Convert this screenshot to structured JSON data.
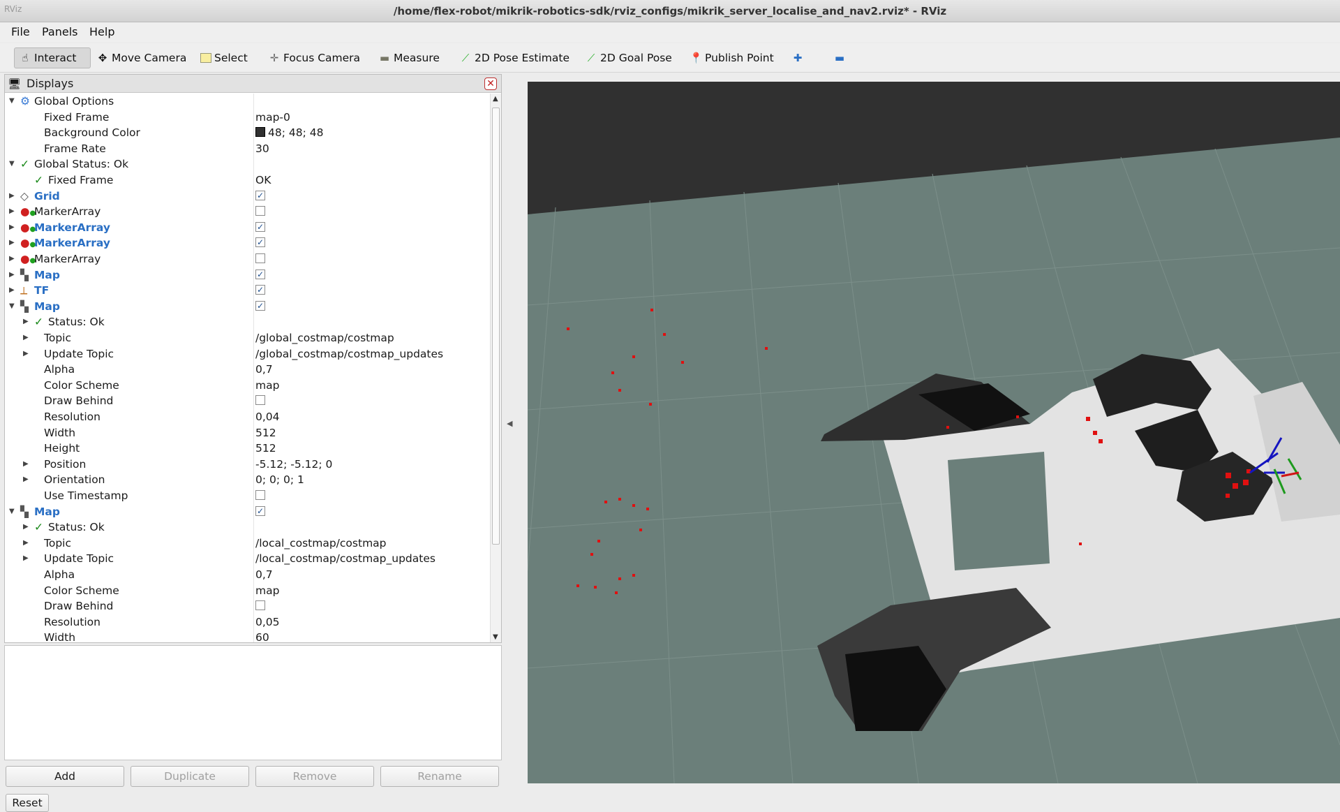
{
  "window": {
    "title": "/home/flex-robot/mikrik-robotics-sdk/rviz_configs/mikrik_server_localise_and_nav2.rviz* - RViz",
    "app_icon_text": "RViz"
  },
  "menu": [
    "File",
    "Panels",
    "Help"
  ],
  "toolbar": [
    {
      "label": "Interact",
      "icon": "hand-pointer-icon",
      "active": true
    },
    {
      "label": "Move Camera",
      "icon": "move-arrows-icon"
    },
    {
      "label": "Select",
      "icon": "select-rect-icon"
    },
    {
      "label": "Focus Camera",
      "icon": "focus-crosshair-icon"
    },
    {
      "label": "Measure",
      "icon": "ruler-icon"
    },
    {
      "label": "2D Pose Estimate",
      "icon": "green-arrow-icon"
    },
    {
      "label": "2D Goal Pose",
      "icon": "green-arrow-icon"
    },
    {
      "label": "Publish Point",
      "icon": "red-pin-icon"
    },
    {
      "label": "",
      "icon": "plus-icon"
    },
    {
      "label": "",
      "icon": "minus-icon"
    }
  ],
  "displays_panel": {
    "title": "Displays",
    "rows": [
      {
        "indent": 0,
        "arrow": "down",
        "icon": "globe-icon",
        "name": "Global Options",
        "value": ""
      },
      {
        "indent": 1,
        "name": "Fixed Frame",
        "value": "map-0"
      },
      {
        "indent": 1,
        "name": "Background Color",
        "value": "48; 48; 48",
        "swatch": "#303030"
      },
      {
        "indent": 1,
        "name": "Frame Rate",
        "value": "30"
      },
      {
        "indent": 0,
        "arrow": "down",
        "icon": "check-icon",
        "name": "Global Status: Ok",
        "value": ""
      },
      {
        "indent": 1,
        "icon": "check-icon",
        "name": "Fixed Frame",
        "value": "OK"
      },
      {
        "indent": 0,
        "arrow": "right",
        "icon": "grid-icon",
        "name": "Grid",
        "bold": true,
        "checkbox": true
      },
      {
        "indent": 0,
        "arrow": "right",
        "icon": "marker-icon",
        "name": "MarkerArray",
        "checkbox": false
      },
      {
        "indent": 0,
        "arrow": "right",
        "icon": "marker-icon",
        "name": "MarkerArray",
        "bold": true,
        "checkbox": true
      },
      {
        "indent": 0,
        "arrow": "right",
        "icon": "marker-icon",
        "name": "MarkerArray",
        "bold": true,
        "checkbox": true
      },
      {
        "indent": 0,
        "arrow": "right",
        "icon": "marker-icon",
        "name": "MarkerArray",
        "checkbox": false
      },
      {
        "indent": 0,
        "arrow": "right",
        "icon": "map-icon",
        "name": "Map",
        "bold": true,
        "checkbox": true
      },
      {
        "indent": 0,
        "arrow": "right",
        "icon": "tf-icon",
        "name": "TF",
        "bold": true,
        "checkbox": true
      },
      {
        "indent": 0,
        "arrow": "down",
        "icon": "map-icon",
        "name": "Map",
        "bold": true,
        "checkbox": true
      },
      {
        "indent": 1,
        "arrow": "right",
        "icon": "check-icon",
        "name": "Status: Ok",
        "value": ""
      },
      {
        "indent": 1,
        "arrow": "right",
        "name": "Topic",
        "value": "/global_costmap/costmap"
      },
      {
        "indent": 1,
        "arrow": "right",
        "name": "Update Topic",
        "value": "/global_costmap/costmap_updates"
      },
      {
        "indent": 1,
        "name": "Alpha",
        "value": "0,7"
      },
      {
        "indent": 1,
        "name": "Color Scheme",
        "value": "map"
      },
      {
        "indent": 1,
        "name": "Draw Behind",
        "checkbox": false
      },
      {
        "indent": 1,
        "name": "Resolution",
        "value": "0,04"
      },
      {
        "indent": 1,
        "name": "Width",
        "value": "512"
      },
      {
        "indent": 1,
        "name": "Height",
        "value": "512"
      },
      {
        "indent": 1,
        "arrow": "right",
        "name": "Position",
        "value": "-5.12; -5.12; 0"
      },
      {
        "indent": 1,
        "arrow": "right",
        "name": "Orientation",
        "value": "0; 0; 0; 1"
      },
      {
        "indent": 1,
        "name": "Use Timestamp",
        "checkbox": false
      },
      {
        "indent": 0,
        "arrow": "down",
        "icon": "map-icon",
        "name": "Map",
        "bold": true,
        "checkbox": true
      },
      {
        "indent": 1,
        "arrow": "right",
        "icon": "check-icon",
        "name": "Status: Ok",
        "value": ""
      },
      {
        "indent": 1,
        "arrow": "right",
        "name": "Topic",
        "value": "/local_costmap/costmap"
      },
      {
        "indent": 1,
        "arrow": "right",
        "name": "Update Topic",
        "value": "/local_costmap/costmap_updates"
      },
      {
        "indent": 1,
        "name": "Alpha",
        "value": "0,7"
      },
      {
        "indent": 1,
        "name": "Color Scheme",
        "value": "map"
      },
      {
        "indent": 1,
        "name": "Draw Behind",
        "checkbox": false
      },
      {
        "indent": 1,
        "name": "Resolution",
        "value": "0,05"
      },
      {
        "indent": 1,
        "name": "Width",
        "value": "60"
      }
    ]
  },
  "buttons": {
    "add": "Add",
    "duplicate": "Duplicate",
    "remove": "Remove",
    "rename": "Rename",
    "reset": "Reset"
  },
  "colors": {
    "viewport_bg": "#303030",
    "grid_floor": "#6b7f7a",
    "accent_blue": "#2a6fc4",
    "status_ok": "#1b8a1b",
    "laser_red": "#e01010"
  }
}
